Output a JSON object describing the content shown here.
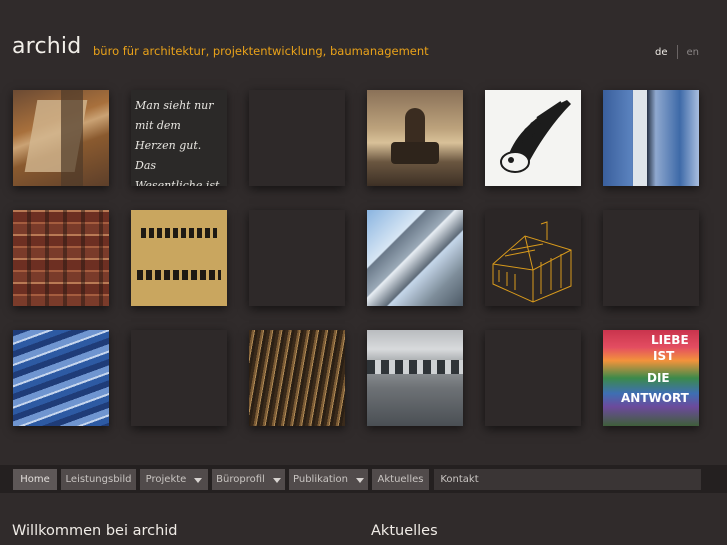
{
  "header": {
    "brand": "archid",
    "tagline": "büro für architektur, projektentwicklung, baumanagement",
    "languages": [
      "de",
      "en"
    ],
    "active_language": "de"
  },
  "tiles": {
    "chalk_text": "Man sieht nur mit dem Herzen gut. Das Wesentliche ist für die Augen unsichtbar.",
    "stairs_words": [
      "LIEBE",
      "IST",
      "DIE",
      "ANTWORT"
    ]
  },
  "nav": {
    "items": [
      {
        "label": "Home",
        "has_dropdown": false
      },
      {
        "label": "Leistungsbild",
        "has_dropdown": false
      },
      {
        "label": "Projekte",
        "has_dropdown": true
      },
      {
        "label": "Büroprofil",
        "has_dropdown": true
      },
      {
        "label": "Publikation",
        "has_dropdown": true
      },
      {
        "label": "Aktuelles",
        "has_dropdown": false
      },
      {
        "label": "Kontakt",
        "has_dropdown": false
      }
    ]
  },
  "content": {
    "welcome_heading": "Willkommen bei archid",
    "news_heading": "Aktuelles"
  },
  "colors": {
    "background": "#302b2b",
    "accent": "#e9a21a"
  }
}
